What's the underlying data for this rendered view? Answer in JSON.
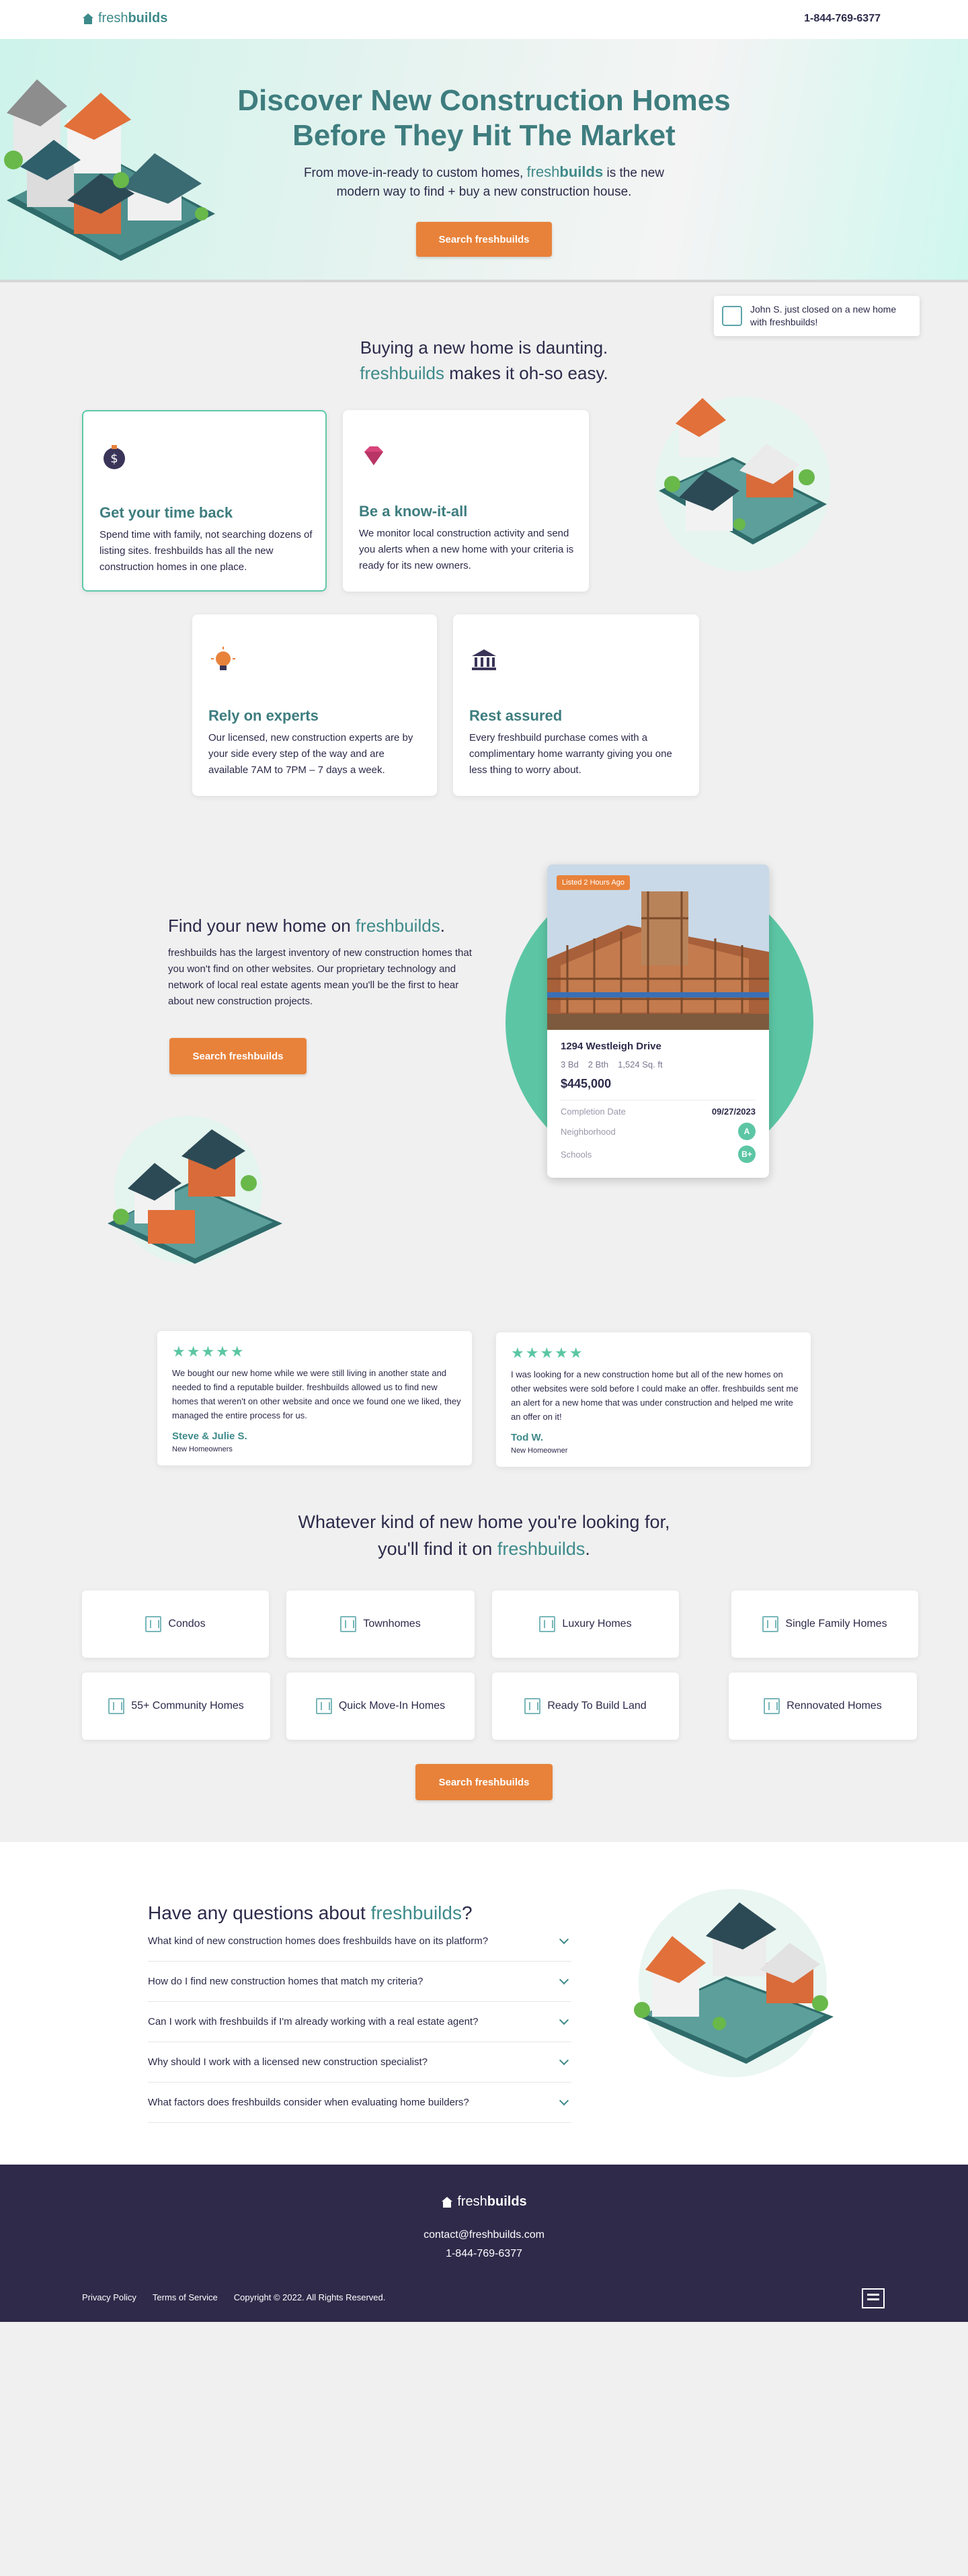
{
  "header": {
    "logo_fresh": "fresh",
    "logo_builds": "builds",
    "phone": "1-844-769-6377"
  },
  "hero": {
    "title_line1": "Discover New Construction Homes",
    "title_line2": "Before They Hit The Market",
    "subtitle_pre": "From move-in-ready to custom homes,",
    "subtitle_fresh": "fresh",
    "subtitle_builds": "builds",
    "subtitle_post": "is the new modern way to find + buy a new construction house.",
    "cta": "Search freshbuilds"
  },
  "notification": {
    "text": "John S. just closed on a new home with freshbuilds!"
  },
  "daunting": {
    "line1": "Buying a new home is daunting.",
    "brand_fresh": "fresh",
    "brand_builds": "builds",
    "line2_post": "makes it oh-so easy."
  },
  "benefits": [
    {
      "title": "Get your time back",
      "text": "Spend time with family, not searching dozens of listing sites. freshbuilds has all the new construction homes in one place.",
      "icon": "money-icon"
    },
    {
      "title": "Be a know-it-all",
      "text": "We monitor local construction activity and send you alerts when a new home with your criteria is ready for its new owners.",
      "icon": "diamond-icon"
    },
    {
      "title": "Rely on experts",
      "text": "Our licensed, new construction experts are by your side every step of the way and are available 7AM to 7PM – 7 days a week.",
      "icon": "lightbulb-icon"
    },
    {
      "title": "Rest assured",
      "text": "Every freshbuild purchase comes with a complimentary home warranty giving you one less thing to worry about.",
      "icon": "bank-icon"
    }
  ],
  "find": {
    "title_pre": "Find your new home on",
    "brand_fresh": "fresh",
    "brand_builds": "builds",
    "title_post": ".",
    "text": "freshbuilds has the largest inventory of new construction homes that you won't find on other websites. Our proprietary technology and network of local real estate agents mean you'll be the first to hear about new construction projects.",
    "cta": "Search freshbuilds"
  },
  "listing": {
    "badge": "Listed 2 Hours Ago",
    "address": "1294 Westleigh Drive",
    "beds": "3 Bd",
    "baths": "2 Bth",
    "sqft": "1,524 Sq. ft",
    "price": "$445,000",
    "completion_label": "Completion Date",
    "completion_value": "09/27/2023",
    "neighborhood_label": "Neighborhood",
    "neighborhood_grade": "A",
    "schools_label": "Schools",
    "schools_grade": "B+"
  },
  "reviews": [
    {
      "stars": "★★★★★",
      "text": "We bought our new home while we were still living in another state and needed to find a reputable builder. freshbuilds allowed us to find new homes that weren't on other website and once we found one we liked, they managed the entire process for us.",
      "name": "Steve & Julie S.",
      "role": "New Homeowners"
    },
    {
      "stars": "★★★★★",
      "text": "I was looking for a new construction home but all of the new homes on other websites were sold before I could make an offer. freshbuilds sent me an alert for a new home that was under construction and helped me write an offer on it!",
      "name": "Tod W.",
      "role": "New Homeowner"
    }
  ],
  "kinds": {
    "line1": "Whatever kind of new home you're looking for,",
    "line2_pre": "you'll find it on",
    "brand_fresh": "fresh",
    "brand_builds": "builds",
    "line2_post": ".",
    "items": [
      "Condos",
      "Townhomes",
      "Luxury Homes",
      "Single Family Homes",
      "55+ Community Homes",
      "Quick Move-In Homes",
      "Ready To Build Land",
      "Rennovated Homes"
    ],
    "cta": "Search freshbuilds"
  },
  "faq": {
    "title_pre": "Have any questions about",
    "brand_fresh": "fresh",
    "brand_builds": "builds",
    "title_post": "?",
    "items": [
      "What kind of new construction homes does freshbuilds have on its platform?",
      "How do I find new construction homes that match my criteria?",
      "Can I work with freshbuilds if I'm already working with a real estate agent?",
      "Why should I work with a licensed new construction specialist?",
      "What factors does freshbuilds consider when evaluating home builders?"
    ]
  },
  "footer": {
    "logo_fresh": "fresh",
    "logo_builds": "builds",
    "email": "contact@freshbuilds.com",
    "phone": "1-844-769-6377",
    "links": [
      "Privacy Policy",
      "Terms of Service",
      "Copyright © 2022. All Rights Reserved."
    ],
    "eho_icon": "equal-housing-icon"
  },
  "colors": {
    "accent": "#e8823a",
    "brand": "#3e8a8a",
    "mint": "#5cc6a4",
    "navy": "#2f2a4a"
  }
}
